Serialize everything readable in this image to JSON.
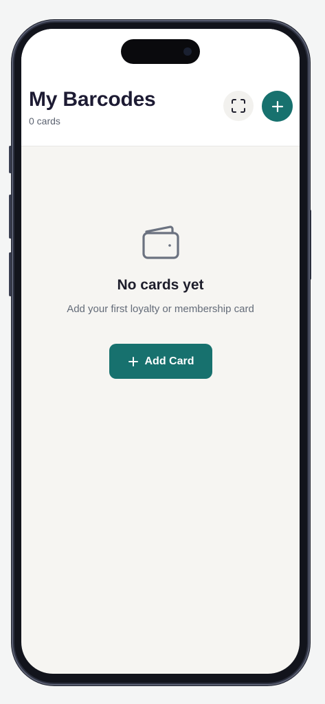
{
  "header": {
    "title": "My Barcodes",
    "card_count": "0 cards",
    "scan_icon": "scan-frame-icon",
    "add_icon": "plus-icon"
  },
  "empty_state": {
    "icon": "wallet-icon",
    "title": "No cards yet",
    "description": "Add your first loyalty or membership card",
    "button_label": "Add Card",
    "button_icon": "plus-icon"
  },
  "colors": {
    "accent": "#17716e",
    "background": "#f6f5f2",
    "header_bg": "#ffffff",
    "title_text": "#1d1b33",
    "muted_text": "#636b78"
  }
}
